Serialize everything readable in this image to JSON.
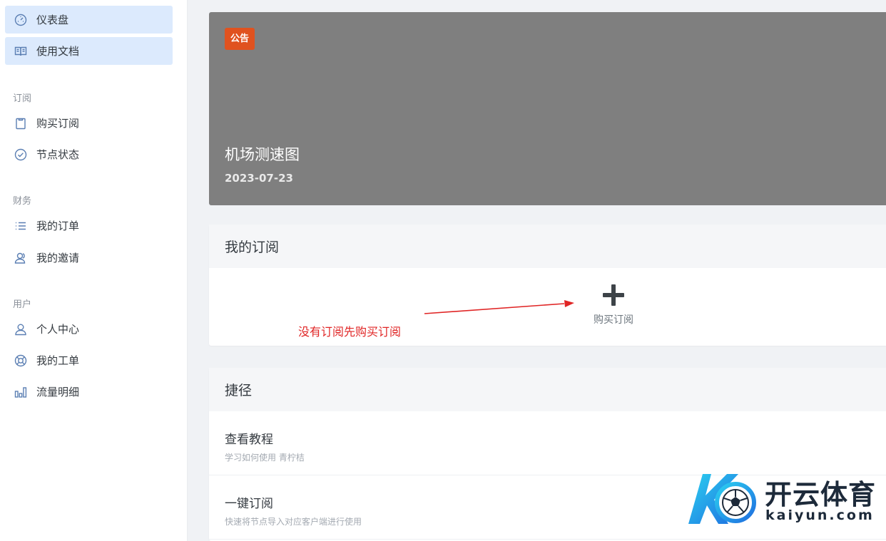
{
  "sidebar": {
    "top_items": [
      {
        "label": "仪表盘",
        "icon": "dashboard-icon",
        "active": true
      },
      {
        "label": "使用文档",
        "icon": "book-icon",
        "active": true
      }
    ],
    "groups": [
      {
        "label": "订阅",
        "items": [
          {
            "label": "购买订阅",
            "icon": "clipboard-icon"
          },
          {
            "label": "节点状态",
            "icon": "check-circle-icon"
          }
        ]
      },
      {
        "label": "财务",
        "items": [
          {
            "label": "我的订单",
            "icon": "list-icon"
          },
          {
            "label": "我的邀请",
            "icon": "users-icon"
          }
        ]
      },
      {
        "label": "用户",
        "items": [
          {
            "label": "个人中心",
            "icon": "user-icon"
          },
          {
            "label": "我的工单",
            "icon": "lifebuoy-icon"
          },
          {
            "label": "流量明细",
            "icon": "bar-chart-icon"
          }
        ]
      }
    ]
  },
  "announcement": {
    "badge": "公告",
    "title": "机场测速图",
    "date": "2023-07-23"
  },
  "subscription": {
    "title": "我的订阅",
    "buy_label": "购买订阅",
    "annotation": "没有订阅先购买订阅"
  },
  "shortcuts": {
    "title": "捷径",
    "items": [
      {
        "title": "查看教程",
        "desc": "学习如何使用 青柠桔"
      },
      {
        "title": "一键订阅",
        "desc": "快速将节点导入对应客户端进行使用"
      }
    ]
  },
  "watermark": {
    "cn": "开云体育",
    "en": "kaiyun.com"
  },
  "colors": {
    "accent": "#dceafd",
    "badge": "#e0521f",
    "annotation": "#e02525",
    "icon": "#5b7fb3"
  }
}
